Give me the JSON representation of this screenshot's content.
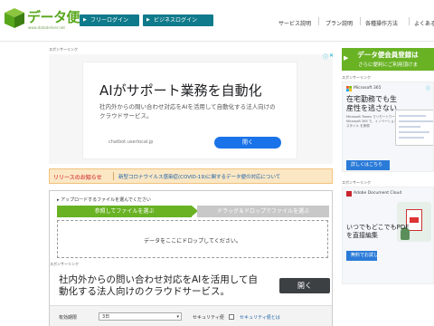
{
  "header": {
    "logo_text": "データ便",
    "logo_url": "www.datadeliver.net",
    "free_login": "フリーログイン",
    "business_login": "ビジネスログイン",
    "nav": [
      "サービス説明",
      "プラン説明",
      "各種操作方法",
      "よくある"
    ]
  },
  "sponsor_label": "スポンサーリンク",
  "ad_main": {
    "title": "AIがサポート業務を自動化",
    "description": "社内外からの問い合わせ対応をAIを活用して自動化する法人向けのクラウドサービス。",
    "url": "chatbot.userlocal.jp",
    "open_button": "開く",
    "info_icon": "ⓘ",
    "close_icon": "✕"
  },
  "notice": {
    "label": "リリースのお知らせ",
    "text": "新型コロナウイルス感染症(COVID-19)に関するデータ便の対応について"
  },
  "upload": {
    "hint": "▸ アップロードするファイルを選んでください",
    "tab_select": "参照してファイルを選ぶ",
    "tab_dnd": "ドラッグ＆ドロップでファイルを選ぶ",
    "drop_text": "データをここにドロップしてください。"
  },
  "ad_second": {
    "text": "社内外からの問い合わせ対応をAIを活用して自動化する法人向けのクラウドサービス。",
    "open_button": "開く"
  },
  "settings": {
    "expiry_label": "有効期限",
    "expiry_value": "3日",
    "security_label": "セキュリティ便",
    "security_link": "セキュリティ便とは"
  },
  "registration_banner": {
    "line1": "データ便会員登録は",
    "line2": "さらに便利にご利用頂けま"
  },
  "right_ad_1": {
    "brand": "Microsoft 365",
    "headline": "在宅勤務でも生産性を逃さない",
    "subtext": "Microsoft Teams でリモートワーク Microsoft 365 で、イノベーションとスタイル を実現",
    "cta": "詳しくはこちら"
  },
  "right_ad_2": {
    "brand": "Adobe Document Cloud",
    "headline": "いつでもどこでもPDFを直接編集",
    "cta": "無料でお試し"
  },
  "colors": {
    "brand_green": "#69b224",
    "login_teal": "#0f7a8b",
    "ad_blue": "#1a73e8",
    "notice_bg": "#fbe7c4"
  }
}
